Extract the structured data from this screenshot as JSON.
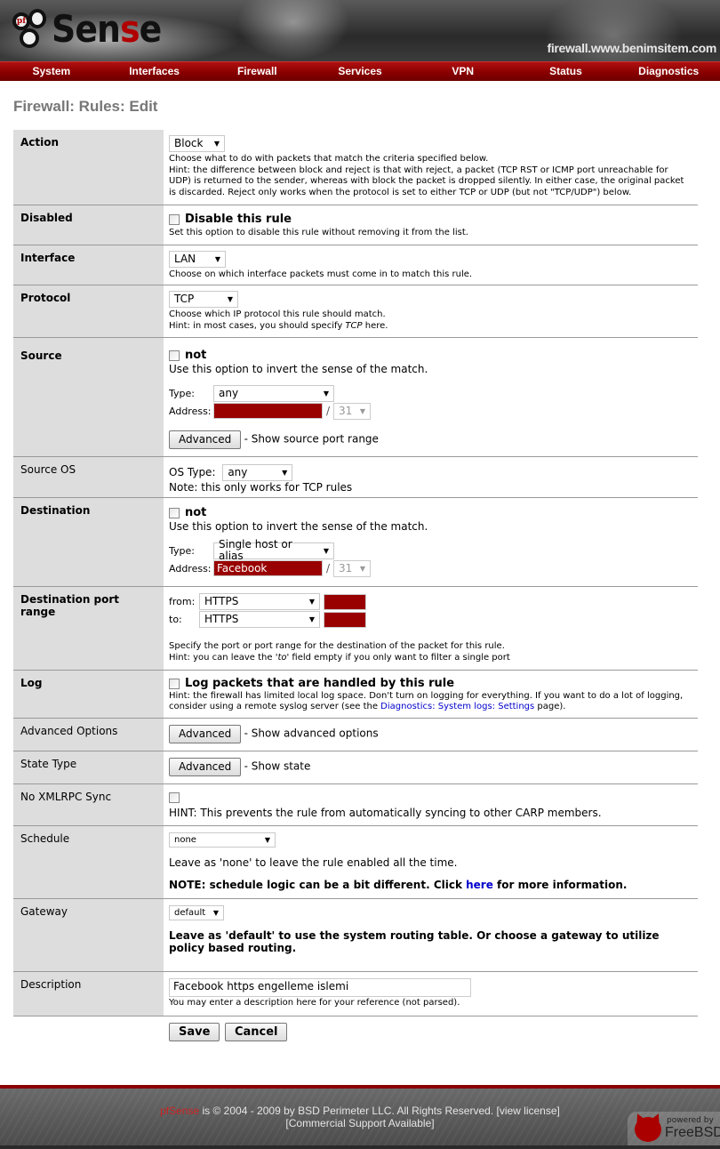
{
  "header": {
    "logo": {
      "prefix": "pf",
      "text_a": "Sen",
      "text_red": "s",
      "text_b": "e"
    },
    "hostname": "firewall.www.benimsitem.com"
  },
  "nav": {
    "items": [
      "System",
      "Interfaces",
      "Firewall",
      "Services",
      "VPN",
      "Status",
      "Diagnostics"
    ]
  },
  "page_title": "Firewall: Rules: Edit",
  "form": {
    "action": {
      "label": "Action",
      "value": "Block",
      "hint1": "Choose what to do with packets that match the criteria specified below.",
      "hint2": "Hint: the difference between block and reject is that with reject, a packet (TCP RST or ICMP port unreachable for UDP) is returned to the sender, whereas with block the packet is dropped silently. In either case, the original packet is discarded. Reject only works when the protocol is set to either TCP or UDP (but not \"TCP/UDP\") below."
    },
    "disabled": {
      "label": "Disabled",
      "checkbox_label": "Disable this rule",
      "checked": false,
      "hint": "Set this option to disable this rule without removing it from the list."
    },
    "interface": {
      "label": "Interface",
      "value": "LAN",
      "hint": "Choose on which interface packets must come in to match this rule."
    },
    "protocol": {
      "label": "Protocol",
      "value": "TCP",
      "hint1": "Choose which IP protocol this rule should match.",
      "hint2_pre": "Hint: in most cases, you should specify ",
      "hint2_em": "TCP",
      "hint2_post": " here."
    },
    "source": {
      "label": "Source",
      "not_label": "not",
      "not_checked": false,
      "not_hint": "Use this option to invert the sense of the match.",
      "type_label": "Type:",
      "type_value": "any",
      "address_label": "Address:",
      "address_value": "",
      "mask_value": "31",
      "advanced_button": "Advanced",
      "advanced_hint": "- Show source port range"
    },
    "source_os": {
      "label": "Source OS",
      "os_type_label": "OS Type:",
      "os_type_value": "any",
      "note": "Note: this only works for TCP rules"
    },
    "destination": {
      "label": "Destination",
      "not_label": "not",
      "not_checked": false,
      "not_hint": "Use this option to invert the sense of the match.",
      "type_label": "Type:",
      "type_value": "Single host or alias",
      "address_label": "Address:",
      "address_value": "Facebook",
      "mask_value": "31"
    },
    "dest_port_range": {
      "label": "Destination port range",
      "from_label": "from:",
      "from_value": "HTTPS",
      "to_label": "to:",
      "to_value": "HTTPS",
      "hint1": "Specify the port or port range for the destination of the packet for this rule.",
      "hint2_pre": "Hint: you can leave the ",
      "hint2_em": "'to'",
      "hint2_post": " field empty if you only want to filter a single port"
    },
    "log": {
      "label": "Log",
      "checkbox_label": "Log packets that are handled by this rule",
      "checked": false,
      "hint_pre": "Hint: the firewall has limited local log space. Don't turn on logging for everything. If you want to do a lot of logging, consider using a remote syslog server (see the ",
      "hint_link": "Diagnostics: System logs: Settings",
      "hint_post": " page)."
    },
    "advanced_options": {
      "label": "Advanced Options",
      "button": "Advanced",
      "hint": "- Show advanced options"
    },
    "state_type": {
      "label": "State Type",
      "button": "Advanced",
      "hint": "- Show state"
    },
    "no_xmlrpc": {
      "label": "No XMLRPC Sync",
      "checked": false,
      "hint": "HINT: This prevents the rule from automatically syncing to other CARP members."
    },
    "schedule": {
      "label": "Schedule",
      "value": "none",
      "hint": "Leave as 'none' to leave the rule enabled all the time.",
      "note_pre": "NOTE: schedule logic can be a bit different. Click ",
      "note_link": "here",
      "note_post": " for more information."
    },
    "gateway": {
      "label": "Gateway",
      "value": "default",
      "hint": "Leave as 'default' to use the system routing table. Or choose a gateway to utilize policy based routing."
    },
    "description": {
      "label": "Description",
      "value": "Facebook https engelleme islemi",
      "hint": "You may enter a description here for your reference (not parsed)."
    },
    "save_button": "Save",
    "cancel_button": "Cancel"
  },
  "footer": {
    "brand": "pfSense",
    "copyright": " is © 2004 - 2009 by BSD Perimeter LLC. All Rights Reserved. ",
    "license_link": "[view license]",
    "support_link": "[Commercial Support Available]",
    "powered_by": "powered by",
    "freebsd": "FreeBSD"
  },
  "colors": {
    "nav_red": "#8a0000",
    "redacted_field": "#990000",
    "label_bg": "#dddddd",
    "title_gray": "#777777",
    "link_blue": "#0000cc"
  }
}
